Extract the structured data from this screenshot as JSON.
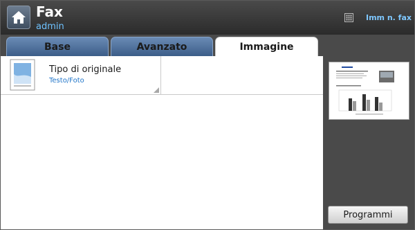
{
  "header": {
    "title": "Fax",
    "user": "admin",
    "fax_memory_label": "Imm n. fax"
  },
  "tabs": [
    {
      "label": "Base",
      "active": false
    },
    {
      "label": "Avanzato",
      "active": false
    },
    {
      "label": "Immagine",
      "active": true
    }
  ],
  "settings": {
    "original_type": {
      "label": "Tipo di originale",
      "value": "Testo/Foto"
    }
  },
  "sidebar": {
    "programs_button": "Programmi"
  },
  "colors": {
    "accent_blue": "#2276c9",
    "tab_blue": "#4e6f9a",
    "header_dark": "#3a3a3a"
  },
  "icons": {
    "home": "home-icon",
    "memory": "grid-icon",
    "document": "document-icon"
  }
}
